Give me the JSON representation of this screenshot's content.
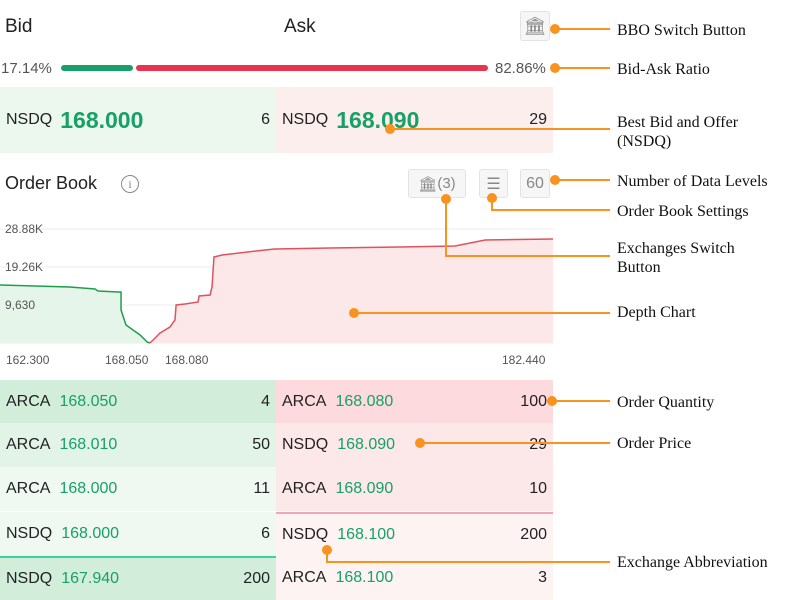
{
  "header": {
    "bid_label": "Bid",
    "ask_label": "Ask",
    "bbo_switch_icon": "bank-icon"
  },
  "ratio": {
    "bid_pct": "17.14%",
    "ask_pct": "82.86%",
    "bid_fraction": 0.1714,
    "bid_color": "#17a067",
    "ask_color": "#e8354d"
  },
  "bbo": {
    "bid": {
      "exchange": "NSDQ",
      "price": "168.000",
      "qty": "6"
    },
    "ask": {
      "exchange": "NSDQ",
      "price": "168.090",
      "qty": "29"
    }
  },
  "order_book": {
    "title": "Order Book",
    "info_icon": "info-icon",
    "exchanges_count": "(3)",
    "settings_icon": "sliders-icon",
    "levels": "60"
  },
  "chart_data": {
    "type": "area",
    "y_ticks": [
      "28.88K",
      "19.26K",
      "9,630"
    ],
    "y_tick_values": [
      28880,
      19260,
      9630
    ],
    "x_ticks": [
      "162.300",
      "168.050",
      "168.080",
      "182.440"
    ],
    "grid": true,
    "series": [
      {
        "side": "bid",
        "color": "#1f9e4a",
        "points": [
          [
            162.3,
            14690
          ],
          [
            164.98,
            14190
          ],
          [
            165.94,
            13680
          ],
          [
            166.06,
            13170
          ],
          [
            166.82,
            12920
          ],
          [
            166.94,
            12920
          ],
          [
            166.94,
            8360
          ],
          [
            167.13,
            4560
          ],
          [
            167.4,
            3290
          ],
          [
            167.67,
            2030
          ],
          [
            167.94,
            250
          ],
          [
            168.05,
            0
          ]
        ]
      },
      {
        "side": "ask",
        "color": "#e0525e",
        "points": [
          [
            168.08,
            0
          ],
          [
            168.19,
            760
          ],
          [
            168.44,
            2530
          ],
          [
            168.79,
            4050
          ],
          [
            168.97,
            5830
          ],
          [
            169.01,
            9630
          ],
          [
            169.33,
            9880
          ],
          [
            169.79,
            10390
          ],
          [
            169.83,
            11910
          ],
          [
            170.22,
            12160
          ],
          [
            170.29,
            14190
          ],
          [
            170.36,
            21790
          ],
          [
            170.65,
            22290
          ],
          [
            172.18,
            23560
          ],
          [
            172.53,
            23810
          ],
          [
            174.49,
            24070
          ],
          [
            176.99,
            24320
          ],
          [
            178.95,
            24570
          ],
          [
            180.02,
            26090
          ],
          [
            182.44,
            26350
          ]
        ]
      }
    ]
  },
  "bids": [
    {
      "exchange": "ARCA",
      "price": "168.050",
      "qty": "4"
    },
    {
      "exchange": "ARCA",
      "price": "168.010",
      "qty": "50"
    },
    {
      "exchange": "ARCA",
      "price": "168.000",
      "qty": "11"
    },
    {
      "exchange": "NSDQ",
      "price": "168.000",
      "qty": "6"
    },
    {
      "exchange": "NSDQ",
      "price": "167.940",
      "qty": "200"
    }
  ],
  "asks": [
    {
      "exchange": "ARCA",
      "price": "168.080",
      "qty": "100"
    },
    {
      "exchange": "NSDQ",
      "price": "168.090",
      "qty": "29"
    },
    {
      "exchange": "ARCA",
      "price": "168.090",
      "qty": "10"
    },
    {
      "exchange": "NSDQ",
      "price": "168.100",
      "qty": "200"
    },
    {
      "exchange": "ARCA",
      "price": "168.100",
      "qty": "3"
    }
  ],
  "annotations": {
    "bbo_switch": "BBO Switch Button",
    "ratio": "Bid-Ask Ratio",
    "best": "Best Bid and Offer (NSDQ)",
    "levels": "Number of Data Levels",
    "settings": "Order Book Settings",
    "exchanges": "Exchanges Switch Button",
    "depth": "Depth Chart",
    "qty": "Order Quantity",
    "price": "Order Price",
    "abbr": "Exchange Abbreviation",
    "color": "#f7931e"
  }
}
